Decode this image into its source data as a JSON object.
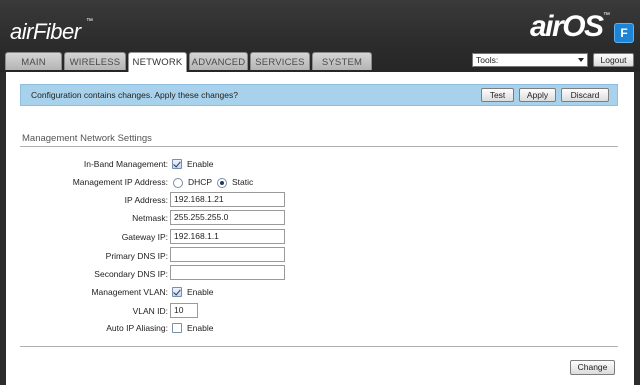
{
  "header": {
    "left_logo": "airFiber",
    "left_logo_tm": "™",
    "right_logo": "airOS",
    "right_logo_tm": "™",
    "right_badge": "F"
  },
  "tabs": [
    {
      "label": "MAIN"
    },
    {
      "label": "WIRELESS"
    },
    {
      "label": "NETWORK"
    },
    {
      "label": "ADVANCED"
    },
    {
      "label": "SERVICES"
    },
    {
      "label": "SYSTEM"
    }
  ],
  "tools": {
    "selected": "Tools:",
    "logout_label": "Logout"
  },
  "banner": {
    "message": "Configuration contains changes. Apply these changes?",
    "test_label": "Test",
    "apply_label": "Apply",
    "discard_label": "Discard"
  },
  "section": {
    "title": "Management Network Settings"
  },
  "form": {
    "inband_label": "In-Band Management:",
    "inband_enable": "Enable",
    "inband_checked": true,
    "mgmt_ip_label": "Management IP Address:",
    "dhcp_label": "DHCP",
    "static_label": "Static",
    "mode_selected": "Static",
    "ip_label": "IP Address:",
    "ip_value": "192.168.1.21",
    "netmask_label": "Netmask:",
    "netmask_value": "255.255.255.0",
    "gateway_label": "Gateway IP:",
    "gateway_value": "192.168.1.1",
    "dns1_label": "Primary DNS IP:",
    "dns1_value": "",
    "dns2_label": "Secondary DNS IP:",
    "dns2_value": "",
    "vlan_label": "Management VLAN:",
    "vlan_enable": "Enable",
    "vlan_checked": true,
    "vlan_id_label": "VLAN ID:",
    "vlan_id_value": "10",
    "alias_label": "Auto IP Aliasing:",
    "alias_enable": "Enable",
    "alias_checked": false
  },
  "footer": {
    "change_label": "Change"
  }
}
